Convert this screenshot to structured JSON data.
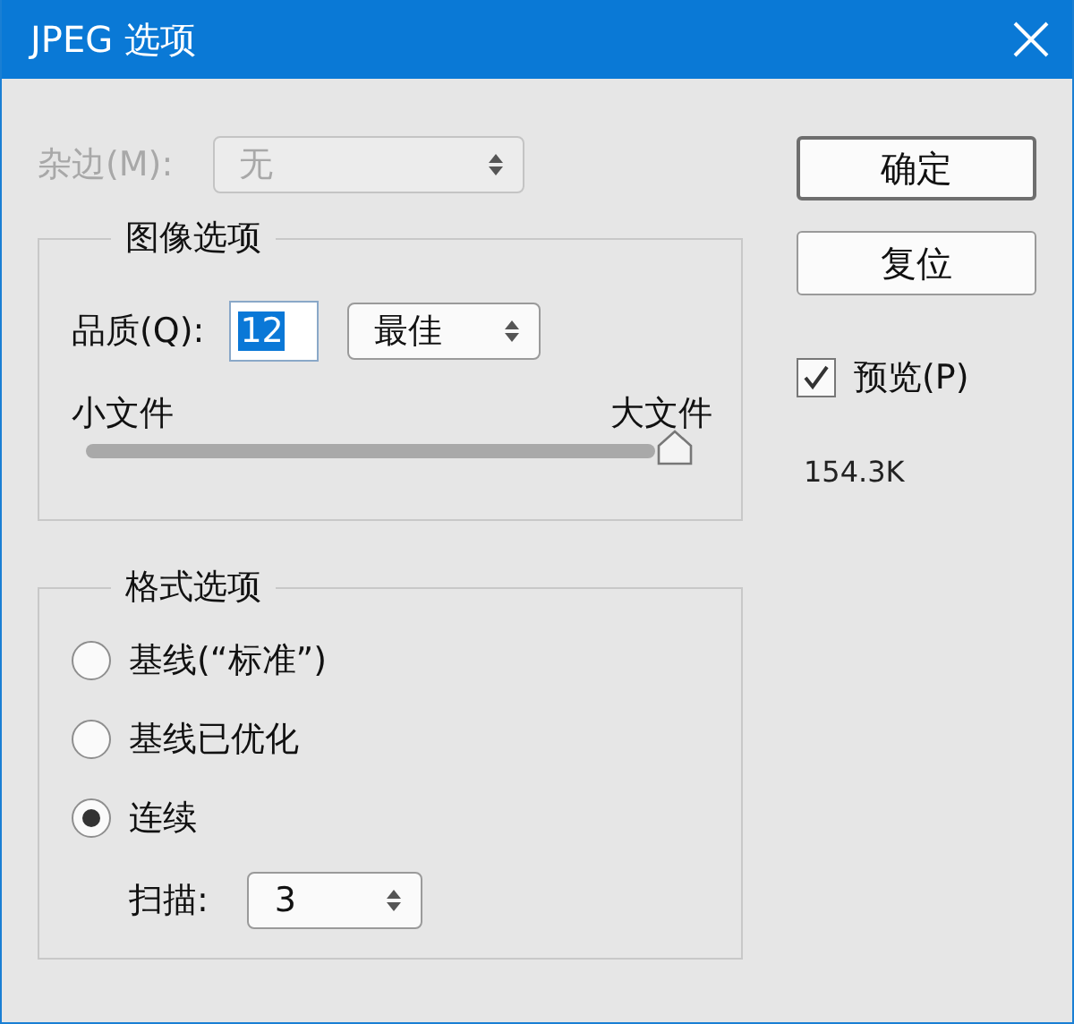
{
  "window": {
    "title": "JPEG 选项"
  },
  "matte": {
    "label": "杂边(M):",
    "value": "无",
    "disabled": true
  },
  "image_options": {
    "title": "图像选项",
    "quality": {
      "label": "品质(Q):",
      "value": "12",
      "text_selected": true
    },
    "quality_preset": "最佳",
    "slider": {
      "min_label": "小文件",
      "max_label": "大文件",
      "level": 1
    }
  },
  "format_options": {
    "title": "格式选项",
    "options": [
      {
        "label": "基线(“标准”)",
        "selected": false
      },
      {
        "label": "基线已优化",
        "selected": false
      },
      {
        "label": "连续",
        "selected": true
      }
    ],
    "scans": {
      "label": "扫描:",
      "value": "3"
    }
  },
  "buttons": [
    {
      "label": "确定",
      "default": true
    },
    {
      "label": "复位",
      "default": false
    }
  ],
  "preview": {
    "label": "预览(P)",
    "checked": true
  },
  "file_size": "154.3K"
}
